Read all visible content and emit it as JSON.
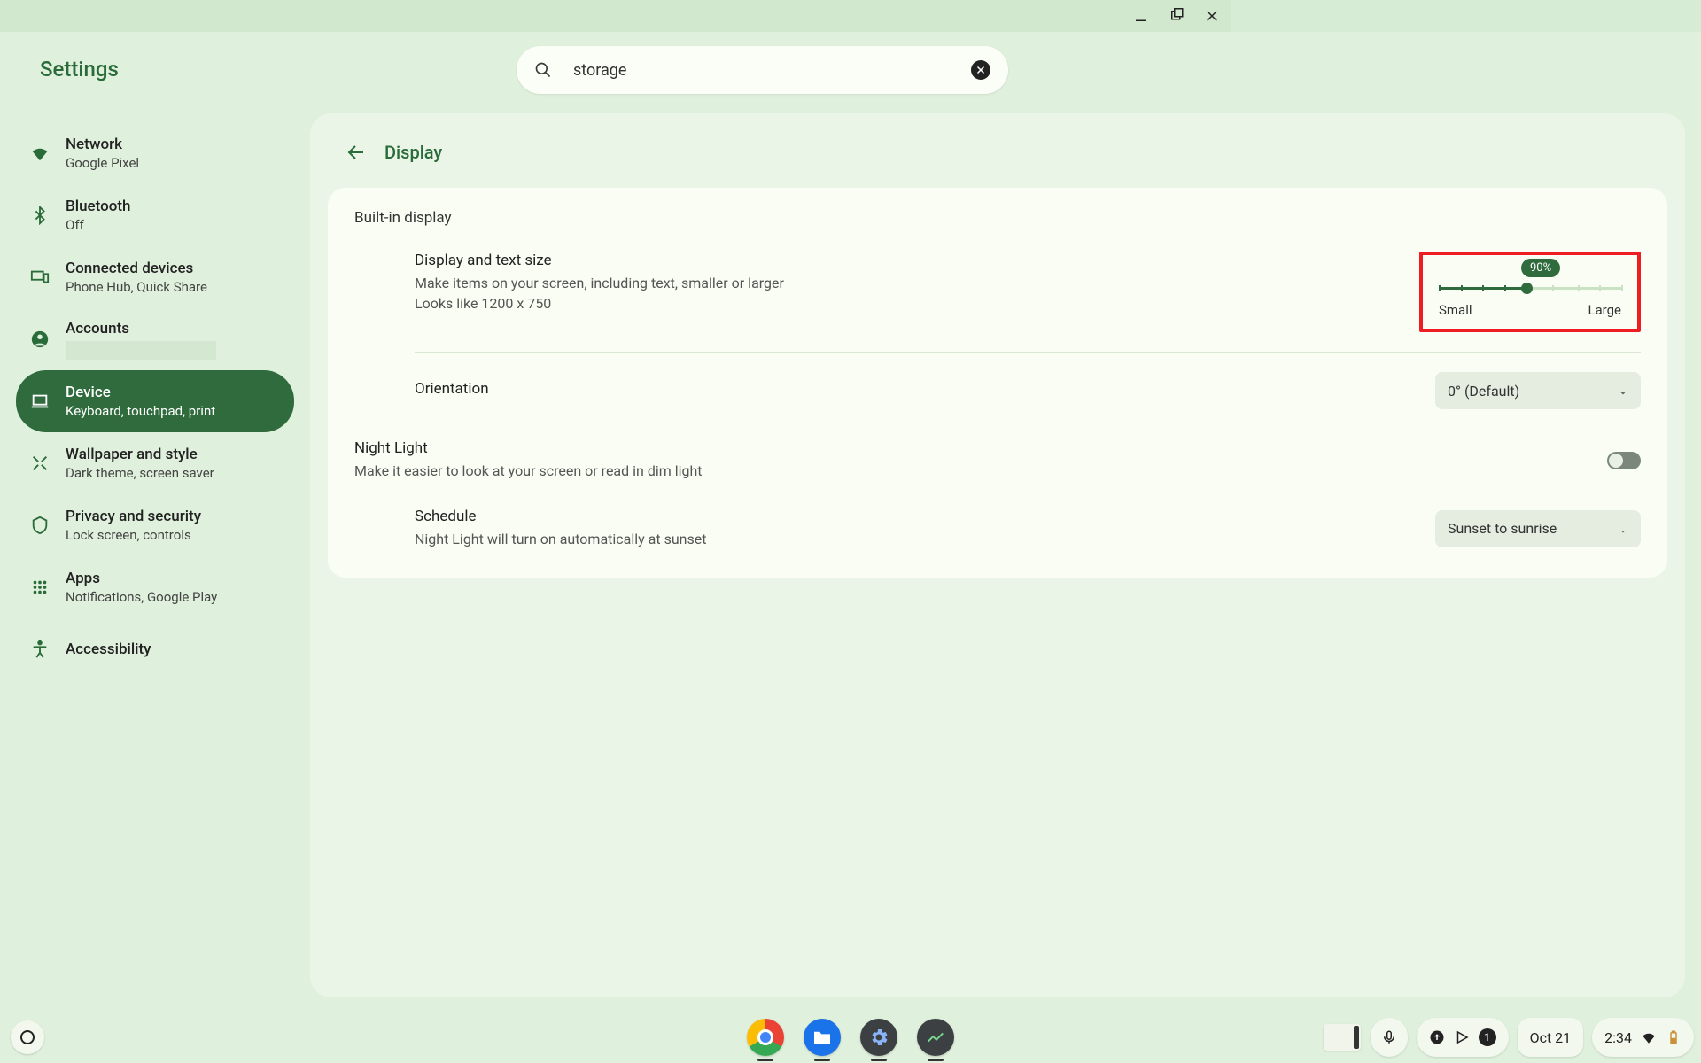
{
  "window": {
    "app_title": "Settings"
  },
  "search": {
    "value": "storage"
  },
  "sidebar": {
    "items": [
      {
        "label": "Network",
        "sublabel": "Google Pixel"
      },
      {
        "label": "Bluetooth",
        "sublabel": "Off"
      },
      {
        "label": "Connected devices",
        "sublabel": "Phone Hub, Quick Share"
      },
      {
        "label": "Accounts",
        "sublabel": ""
      },
      {
        "label": "Device",
        "sublabel": "Keyboard, touchpad, print"
      },
      {
        "label": "Wallpaper and style",
        "sublabel": "Dark theme, screen saver"
      },
      {
        "label": "Privacy and security",
        "sublabel": "Lock screen, controls"
      },
      {
        "label": "Apps",
        "sublabel": "Notifications, Google Play"
      },
      {
        "label": "Accessibility",
        "sublabel": ""
      }
    ]
  },
  "main": {
    "title": "Display",
    "section1_title": "Built-in display",
    "display_size": {
      "title": "Display and text size",
      "desc1": "Make items on your screen, including text, smaller or larger",
      "desc2": "Looks like 1200 x 750",
      "value_label": "90%",
      "slider_small": "Small",
      "slider_large": "Large"
    },
    "orientation": {
      "title": "Orientation",
      "value": "0° (Default)"
    },
    "nightlight": {
      "title": "Night Light",
      "desc": "Make it easier to look at your screen or read in dim light"
    },
    "schedule": {
      "title": "Schedule",
      "desc": "Night Light will turn on automatically at sunset",
      "value": "Sunset to sunrise"
    }
  },
  "shelf": {
    "date": "Oct 21",
    "time": "2:34",
    "badge": "1"
  }
}
